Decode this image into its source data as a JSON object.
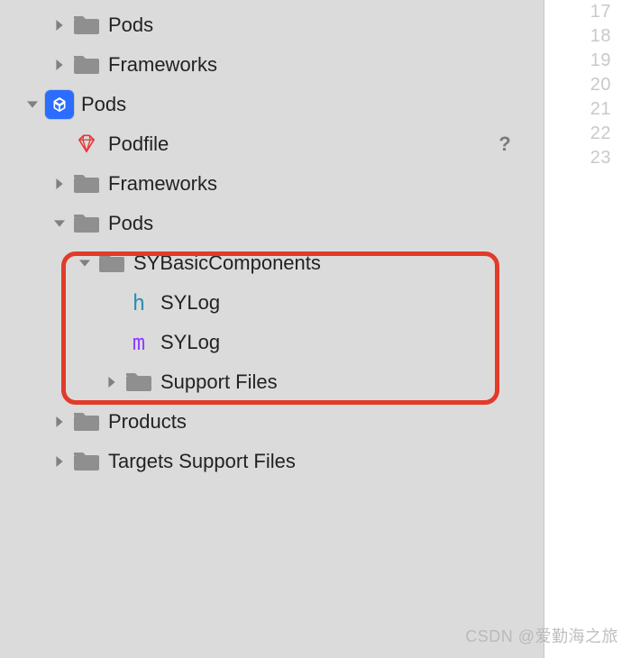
{
  "gutter": {
    "lines": [
      "17",
      "18",
      "19",
      "20",
      "21",
      "22",
      "23"
    ]
  },
  "tree": [
    {
      "id": "top-pods",
      "indent": 56,
      "disclosure": "right",
      "icon": "folder",
      "label": "Pods"
    },
    {
      "id": "top-frameworks",
      "indent": 56,
      "disclosure": "right",
      "icon": "folder",
      "label": "Frameworks"
    },
    {
      "id": "project-pods",
      "indent": 26,
      "disclosure": "down",
      "icon": "project",
      "label": "Pods"
    },
    {
      "id": "podfile",
      "indent": 56,
      "disclosure": "none",
      "icon": "ruby",
      "label": "Podfile",
      "status": "?"
    },
    {
      "id": "frameworks-2",
      "indent": 56,
      "disclosure": "right",
      "icon": "folder",
      "label": "Frameworks"
    },
    {
      "id": "pods-2",
      "indent": 56,
      "disclosure": "down",
      "icon": "folder",
      "label": "Pods"
    },
    {
      "id": "sybasic",
      "indent": 84,
      "disclosure": "down",
      "icon": "folder",
      "label": "SYBasicComponents"
    },
    {
      "id": "sylog-h",
      "indent": 114,
      "disclosure": "none",
      "icon": "h",
      "label": "SYLog"
    },
    {
      "id": "sylog-m",
      "indent": 114,
      "disclosure": "none",
      "icon": "m",
      "label": "SYLog"
    },
    {
      "id": "support-files",
      "indent": 114,
      "disclosure": "right",
      "icon": "folder",
      "label": "Support Files"
    },
    {
      "id": "products",
      "indent": 56,
      "disclosure": "right",
      "icon": "folder",
      "label": "Products"
    },
    {
      "id": "targets-support",
      "indent": 56,
      "disclosure": "right",
      "icon": "folder",
      "label": "Targets Support Files"
    }
  ],
  "watermark": "CSDN @爱勤海之旅"
}
